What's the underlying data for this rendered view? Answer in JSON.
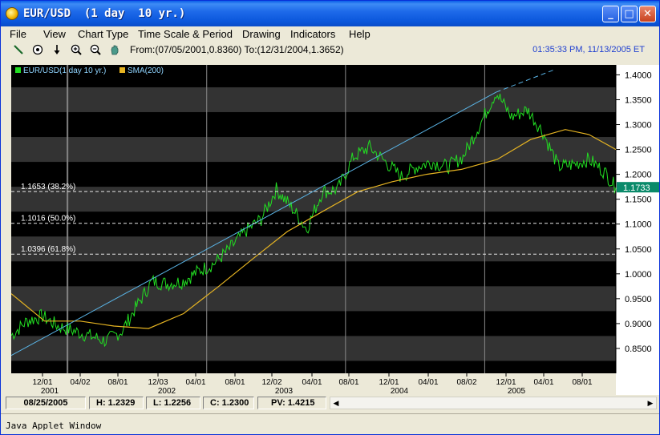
{
  "window": {
    "title": "EUR/USD  (1 day  10 yr.)",
    "buttons": {
      "minimize": "_",
      "maximize": "□",
      "close": "✕"
    }
  },
  "menu": [
    "File",
    "View",
    "Chart Type",
    "Time Scale & Period",
    "Drawing",
    "Indicators",
    "Help"
  ],
  "toolbar": {
    "tools": [
      "draw-line-icon",
      "crosshair-icon",
      "arrow-down-icon",
      "zoom-in-icon",
      "zoom-out-icon",
      "pan-hand-icon"
    ],
    "range_text": "From:(07/05/2001,0.8360) To:(12/31/2004,1.3652)",
    "clock": "01:35:33 PM, 11/13/2005 ET"
  },
  "legend": {
    "price_label": "EUR/USD(1 day  10 yr.)",
    "sma_label": "SMA(200)"
  },
  "colors": {
    "price": "#22dd22",
    "sma": "#e6b422",
    "trendline": "#5ab4e6",
    "current_badge": "#0a8a6a",
    "clock": "#2040d0"
  },
  "fib_levels": [
    {
      "value": 1.1653,
      "label": "1.1653 (38.2%)"
    },
    {
      "value": 1.1016,
      "label": "1.1016 (50.0%)"
    },
    {
      "value": 1.0396,
      "label": "1.0396 (61.8%)"
    }
  ],
  "current_price": "1.1733",
  "status": {
    "date": "08/25/2005",
    "high": "H: 1.2329",
    "low": "L: 1.2256",
    "close": "C: 1.2300",
    "pv": "PV: 1.4215"
  },
  "applet": "Java Applet Window",
  "chart_data": {
    "type": "line",
    "series": [
      {
        "name": "EUR/USD(1 day  10 yr.)",
        "x": [
          "2001-07-05",
          "2001-08-15",
          "2001-09-25",
          "2001-11-05",
          "2001-12-17",
          "2002-01-28",
          "2002-03-11",
          "2002-04-22",
          "2002-05-31",
          "2002-07-10",
          "2002-08-20",
          "2002-09-30",
          "2002-11-08",
          "2002-12-19",
          "2003-01-30",
          "2003-03-12",
          "2003-04-23",
          "2003-06-02",
          "2003-07-11",
          "2003-08-21",
          "2003-10-01",
          "2003-11-11",
          "2003-12-22",
          "2004-02-02",
          "2004-03-15",
          "2004-04-26",
          "2004-06-04",
          "2004-07-15",
          "2004-08-25",
          "2004-10-05",
          "2004-11-15",
          "2004-12-31",
          "2005-02-10",
          "2005-03-23",
          "2005-05-03",
          "2005-06-13",
          "2005-07-22",
          "2005-09-01",
          "2005-10-12",
          "2005-11-11"
        ],
        "y": [
          0.876,
          0.905,
          0.915,
          0.895,
          0.885,
          0.875,
          0.865,
          0.885,
          0.935,
          0.985,
          0.98,
          0.985,
          1.005,
          1.02,
          1.05,
          1.085,
          1.11,
          1.17,
          1.135,
          1.09,
          1.165,
          1.17,
          1.235,
          1.255,
          1.225,
          1.195,
          1.215,
          1.225,
          1.215,
          1.235,
          1.295,
          1.365,
          1.315,
          1.33,
          1.285,
          1.215,
          1.22,
          1.23,
          1.205,
          1.173
        ]
      },
      {
        "name": "SMA(200)",
        "x": [
          "2001-07-05",
          "2001-10-01",
          "2002-01-02",
          "2002-04-01",
          "2002-07-01",
          "2002-10-01",
          "2003-01-02",
          "2003-04-01",
          "2003-07-01",
          "2003-10-01",
          "2004-01-02",
          "2004-04-01",
          "2004-07-01",
          "2004-10-01",
          "2005-01-03",
          "2005-04-01",
          "2005-07-01",
          "2005-09-01",
          "2005-11-11"
        ],
        "y": [
          0.96,
          0.905,
          0.905,
          0.895,
          0.89,
          0.92,
          0.975,
          1.03,
          1.085,
          1.125,
          1.165,
          1.185,
          1.2,
          1.21,
          1.23,
          1.27,
          1.29,
          1.28,
          1.25
        ]
      },
      {
        "name": "",
        "x": [
          "2001-07-05",
          "2004-12-31",
          "2005-06-01"
        ],
        "y": [
          0.836,
          1.3652,
          1.41
        ]
      }
    ],
    "ylim": [
      0.8,
      1.42
    ],
    "yticks": [
      "0.8500",
      "0.9000",
      "0.9500",
      "1.0000",
      "1.0500",
      "1.1000",
      "1.1500",
      "1.2000",
      "1.2500",
      "1.3000",
      "1.3500",
      "1.4000"
    ],
    "xtick_labels": [
      "12/01",
      "04/02",
      "08/01",
      "12/03",
      "04/01",
      "08/01",
      "12/02",
      "04/01",
      "08/01",
      "12/01",
      "04/01",
      "08/02",
      "12/01",
      "04/01",
      "08/01"
    ],
    "year_labels": [
      "2001",
      "2002",
      "2003",
      "2004",
      "2005"
    ],
    "grid": true,
    "legend_position": "top-left"
  }
}
